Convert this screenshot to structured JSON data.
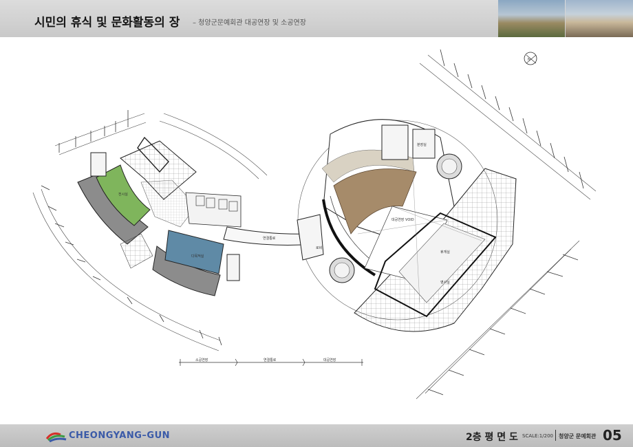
{
  "header": {
    "title": "시민의 휴식 및 문화활동의 장",
    "subtitle": "– 청양군문예회관 대공연장 및 소공연장"
  },
  "plan": {
    "rooms": {
      "room_a": "전시실",
      "room_b": "다목적실",
      "corridor": "연결통로",
      "void": "대공연장 VOID",
      "lobby": "로비",
      "room_c": "분장실",
      "room_d": "휴게실",
      "room_e": "영사실"
    },
    "section_labels": [
      "소공연장",
      "연결통로",
      "대공연장"
    ],
    "north_mark": "N"
  },
  "footer": {
    "logo": "CHEONGYANG–GUN",
    "plan_title": "2층 평 면 도",
    "scale": "SCALE:1/200",
    "building": "청양군 문예회관",
    "page": "05"
  },
  "colors": {
    "green_room": "#7fb55c",
    "blue_room": "#5f8aa6",
    "seating": "#a68b6a",
    "logo_blue": "#3a5aa8",
    "logo_green": "#3c9a44",
    "logo_red": "#d5312b"
  }
}
